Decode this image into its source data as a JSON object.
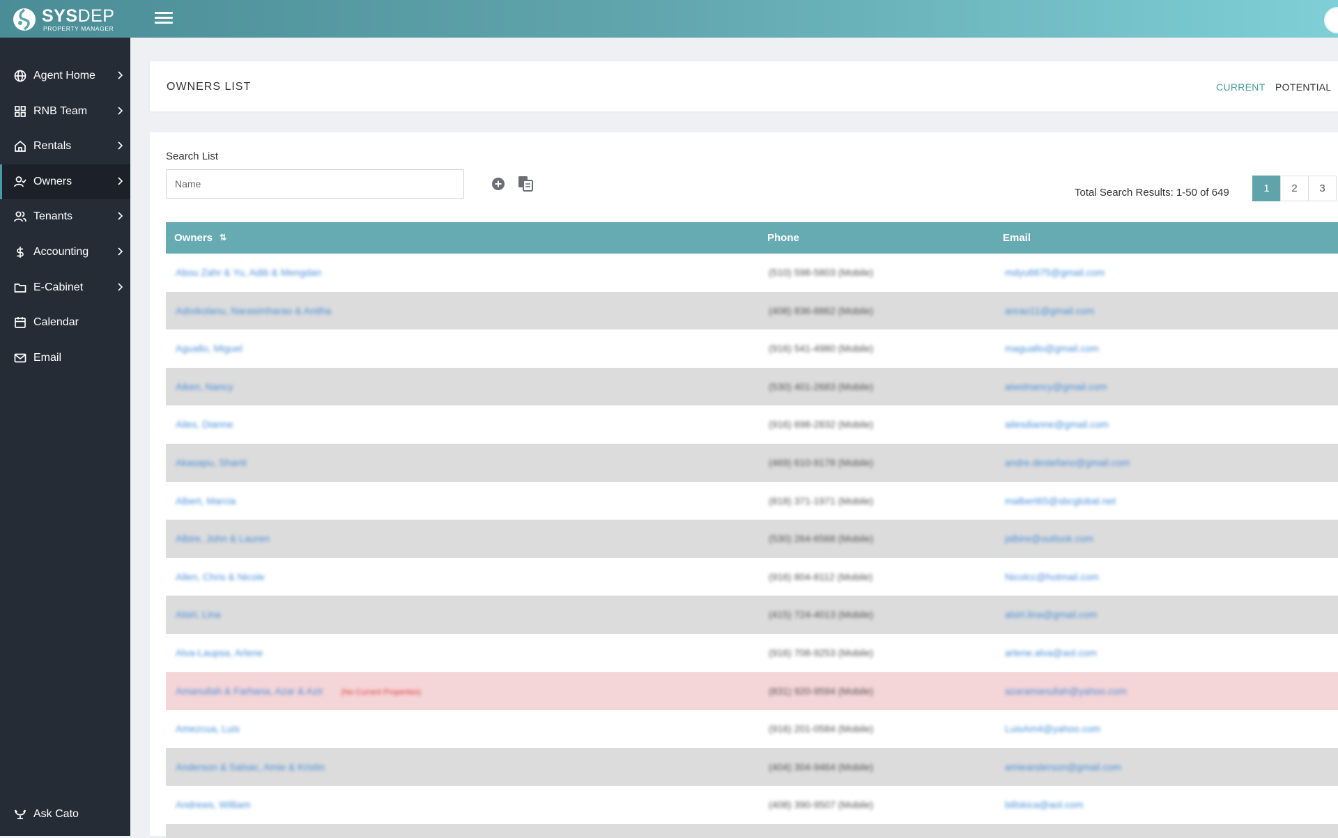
{
  "app": {
    "brand_bold": "SYS",
    "brand_light": "DEP",
    "brand_sub": "PROPERTY MANAGER",
    "accent": "#5fa3ab",
    "sidebar_bg": "#262c35"
  },
  "sidebar": {
    "items": [
      {
        "label": "Agent Home",
        "icon": "globe-icon",
        "has_chevron": true
      },
      {
        "label": "RNB Team",
        "icon": "grid-icon",
        "has_chevron": true
      },
      {
        "label": "Rentals",
        "icon": "home-icon",
        "has_chevron": true
      },
      {
        "label": "Owners",
        "icon": "user-check-icon",
        "has_chevron": true,
        "active": true
      },
      {
        "label": "Tenants",
        "icon": "users-icon",
        "has_chevron": true
      },
      {
        "label": "Accounting",
        "icon": "dollar-icon",
        "has_chevron": true
      },
      {
        "label": "E-Cabinet",
        "icon": "folder-icon",
        "has_chevron": true
      },
      {
        "label": "Calendar",
        "icon": "calendar-icon",
        "has_chevron": false
      },
      {
        "label": "Email",
        "icon": "mail-icon",
        "has_chevron": false
      }
    ],
    "bottom_item": {
      "label": "Ask Cato",
      "icon": "ask-icon"
    }
  },
  "header": {
    "title": "OWNERS LIST",
    "tab_current": "CURRENT",
    "tab_potential": "POTENTIAL"
  },
  "search": {
    "label": "Search List",
    "placeholder": "Name",
    "value": ""
  },
  "results": {
    "total_text": "Total Search Results: 1-50 of 649"
  },
  "pagination": {
    "pages": [
      "1",
      "2",
      "3"
    ],
    "active": "1"
  },
  "table": {
    "headers": {
      "owners": "Owners",
      "phone": "Phone",
      "email": "Email"
    },
    "rows": [
      {
        "name": "Abou Zahr & Yu, Adib & Mengdan",
        "phone": "(510) 598-5803 (Mobile)",
        "email": "mdyu6675@gmail.com"
      },
      {
        "name": "Adivikolanu, Narasimharao & Anitha",
        "phone": "(408) 836-8862 (Mobile)",
        "email": "anrao11@gmail.com"
      },
      {
        "name": "Aguallo, Miguel",
        "phone": "(916) 541-4980 (Mobile)",
        "email": "maguallo@gmail.com"
      },
      {
        "name": "Aiken, Nancy",
        "phone": "(530) 401-2683 (Mobile)",
        "email": "aiwslnancy@gmail.com"
      },
      {
        "name": "Ailes, Dianne",
        "phone": "(916) 698-2832 (Mobile)",
        "email": "ailesdianne@gmail.com"
      },
      {
        "name": "Akasapu, Shanti",
        "phone": "(469) 610-9178 (Mobile)",
        "email": "andre.destefano@gmail.com"
      },
      {
        "name": "Albert, Marcia",
        "phone": "(818) 371-1971 (Mobile)",
        "email": "malbert65@sbcglobal.net"
      },
      {
        "name": "Albire, John & Lauren",
        "phone": "(530) 264-6568 (Mobile)",
        "email": "jalbire@outlook.com"
      },
      {
        "name": "Allen, Chris & Nicole",
        "phone": "(916) 804-8112 (Mobile)",
        "email": "Nicolcc@hotmail.com"
      },
      {
        "name": "Alsiri, Lina",
        "phone": "(415) 724-4013 (Mobile)",
        "email": "alsiri.lina@gmail.com"
      },
      {
        "name": "Alva-Laupsa, Arlene",
        "phone": "(916) 708-9253 (Mobile)",
        "email": "arlene.alva@aol.com"
      },
      {
        "name": "Amanullah & Farhana, Azar & Azir",
        "note": "(No Current Properties)",
        "phone": "(831) 920-9594 (Mobile)",
        "email": "azaramanullah@yahoo.com",
        "warn": true
      },
      {
        "name": "Amezcua, Luis",
        "phone": "(916) 201-0584 (Mobile)",
        "email": "LuisAm4@yahoo.com"
      },
      {
        "name": "Anderson & Salsac, Amie & Kristin",
        "phone": "(404) 304-9464 (Mobile)",
        "email": "amieanderson@gmail.com"
      },
      {
        "name": "Andrews, William",
        "phone": "(408) 390-9507 (Mobile)",
        "email": "billskica@aol.com"
      }
    ]
  }
}
